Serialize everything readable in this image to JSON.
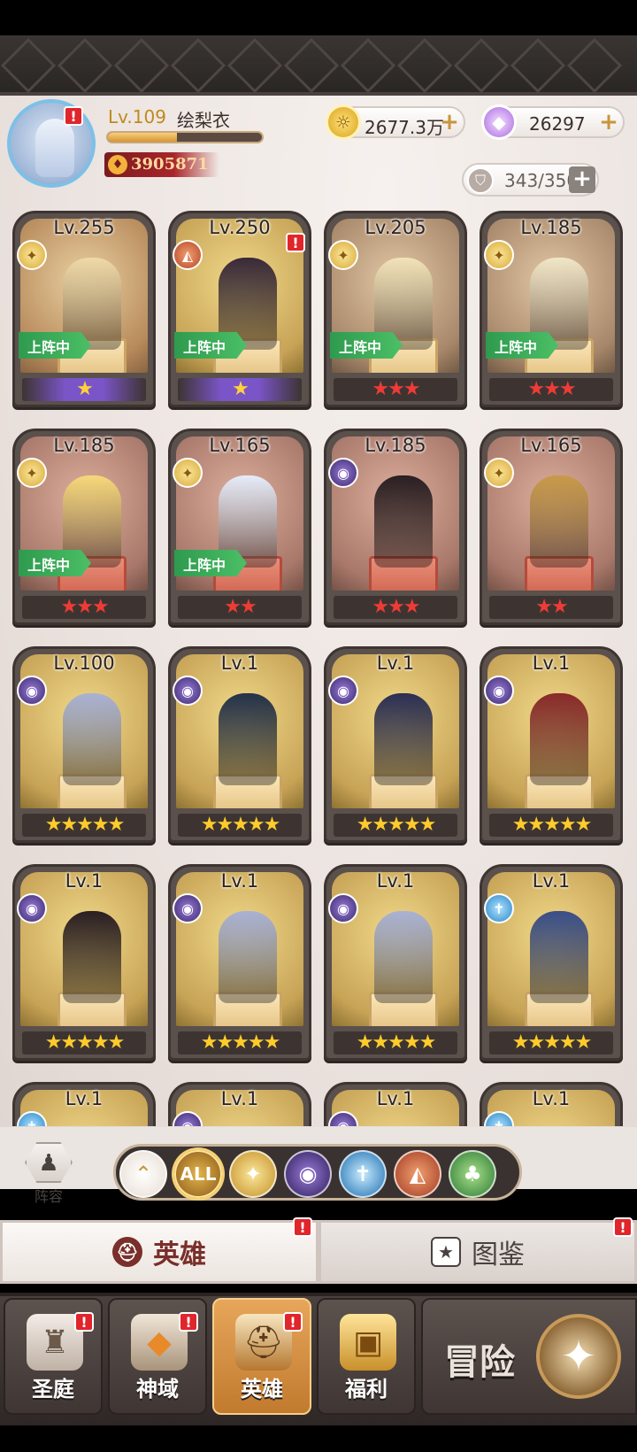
{
  "player": {
    "level": "Lv.109",
    "name": "绘梨衣",
    "xp_fraction": 0.45,
    "power": "3905871"
  },
  "currency": {
    "gold": "2677.3万",
    "diamonds": "26297",
    "capacity": "343/350"
  },
  "heroes": [
    {
      "level": "Lv.255",
      "faction": "light",
      "deployed": true,
      "stars": "★",
      "star_color": "purple",
      "theme": "warm",
      "alert": false,
      "hero_color": "#f0d9a8"
    },
    {
      "level": "Lv.250",
      "faction": "beast",
      "deployed": true,
      "stars": "★",
      "star_color": "purple",
      "theme": "gold",
      "alert": true,
      "hero_color": "#3a2a3a"
    },
    {
      "level": "Lv.205",
      "faction": "light",
      "deployed": true,
      "stars": "★★★",
      "star_color": "red",
      "theme": "tan",
      "alert": false,
      "hero_color": "#f3e3b8"
    },
    {
      "level": "Lv.185",
      "faction": "light",
      "deployed": true,
      "stars": "★★★",
      "star_color": "red",
      "theme": "tan",
      "alert": false,
      "hero_color": "#f2e6c8"
    },
    {
      "level": "Lv.185",
      "faction": "light",
      "deployed": true,
      "stars": "★★★",
      "star_color": "red",
      "theme": "red",
      "alert": false,
      "hero_color": "#f6d87a"
    },
    {
      "level": "Lv.165",
      "faction": "light",
      "deployed": true,
      "stars": "★★",
      "star_color": "red",
      "theme": "red",
      "alert": false,
      "hero_color": "#e6ecfa"
    },
    {
      "level": "Lv.185",
      "faction": "dark",
      "deployed": false,
      "stars": "★★★",
      "star_color": "red",
      "theme": "red",
      "alert": false,
      "hero_color": "#2a1f22"
    },
    {
      "level": "Lv.165",
      "faction": "light",
      "deployed": false,
      "stars": "★★",
      "star_color": "red",
      "theme": "red",
      "alert": false,
      "hero_color": "#c99a4a"
    },
    {
      "level": "Lv.100",
      "faction": "dark",
      "deployed": false,
      "stars": "★★★★★",
      "star_color": "gold",
      "theme": "gold",
      "alert": false,
      "hero_color": "#a9b2d4"
    },
    {
      "level": "Lv.1",
      "faction": "dark",
      "deployed": false,
      "stars": "★★★★★",
      "star_color": "gold",
      "theme": "gold",
      "alert": false,
      "hero_color": "#24324a"
    },
    {
      "level": "Lv.1",
      "faction": "dark",
      "deployed": false,
      "stars": "★★★★★",
      "star_color": "gold",
      "theme": "gold",
      "alert": false,
      "hero_color": "#2b2f55"
    },
    {
      "level": "Lv.1",
      "faction": "dark",
      "deployed": false,
      "stars": "★★★★★",
      "star_color": "gold",
      "theme": "gold",
      "alert": false,
      "hero_color": "#8a2a2a"
    },
    {
      "level": "Lv.1",
      "faction": "dark",
      "deployed": false,
      "stars": "★★★★★",
      "star_color": "gold",
      "theme": "gold",
      "alert": false,
      "hero_color": "#2a1f22"
    },
    {
      "level": "Lv.1",
      "faction": "dark",
      "deployed": false,
      "stars": "★★★★★",
      "star_color": "gold",
      "theme": "gold",
      "alert": false,
      "hero_color": "#a9b2d4"
    },
    {
      "level": "Lv.1",
      "faction": "dark",
      "deployed": false,
      "stars": "★★★★★",
      "star_color": "gold",
      "theme": "gold",
      "alert": false,
      "hero_color": "#a9b2d4"
    },
    {
      "level": "Lv.1",
      "faction": "holy",
      "deployed": false,
      "stars": "★★★★★",
      "star_color": "gold",
      "theme": "gold",
      "alert": false,
      "hero_color": "#3a4f8a"
    },
    {
      "level": "Lv.1",
      "faction": "holy",
      "deployed": false,
      "stars": "",
      "star_color": "gold",
      "theme": "gold",
      "alert": false,
      "hero_color": "#e8ecf5"
    },
    {
      "level": "Lv.1",
      "faction": "dark",
      "deployed": false,
      "stars": "",
      "star_color": "gold",
      "theme": "gold",
      "alert": false,
      "hero_color": "#5a4a4a"
    },
    {
      "level": "Lv.1",
      "faction": "dark",
      "deployed": false,
      "stars": "",
      "star_color": "gold",
      "theme": "gold",
      "alert": false,
      "hero_color": "#5a4a4a"
    },
    {
      "level": "Lv.1",
      "faction": "holy",
      "deployed": false,
      "stars": "",
      "star_color": "gold",
      "theme": "gold",
      "alert": false,
      "hero_color": "#5a4a4a"
    }
  ],
  "labels": {
    "deployed": "上阵中",
    "team": "阵容",
    "filter_all": "ALL"
  },
  "filters": [
    "up",
    "all",
    "light",
    "dark",
    "holy",
    "beast",
    "nature"
  ],
  "tabs": {
    "heroes": "英雄",
    "codex": "图鉴"
  },
  "nav": {
    "court": "圣庭",
    "domain": "神域",
    "heroes": "英雄",
    "welfare": "福利",
    "adventure": "冒险"
  },
  "colors": {
    "alert": "#e0252b",
    "deploy_green": "#3aaa58",
    "active_nav": "#d48d42"
  }
}
